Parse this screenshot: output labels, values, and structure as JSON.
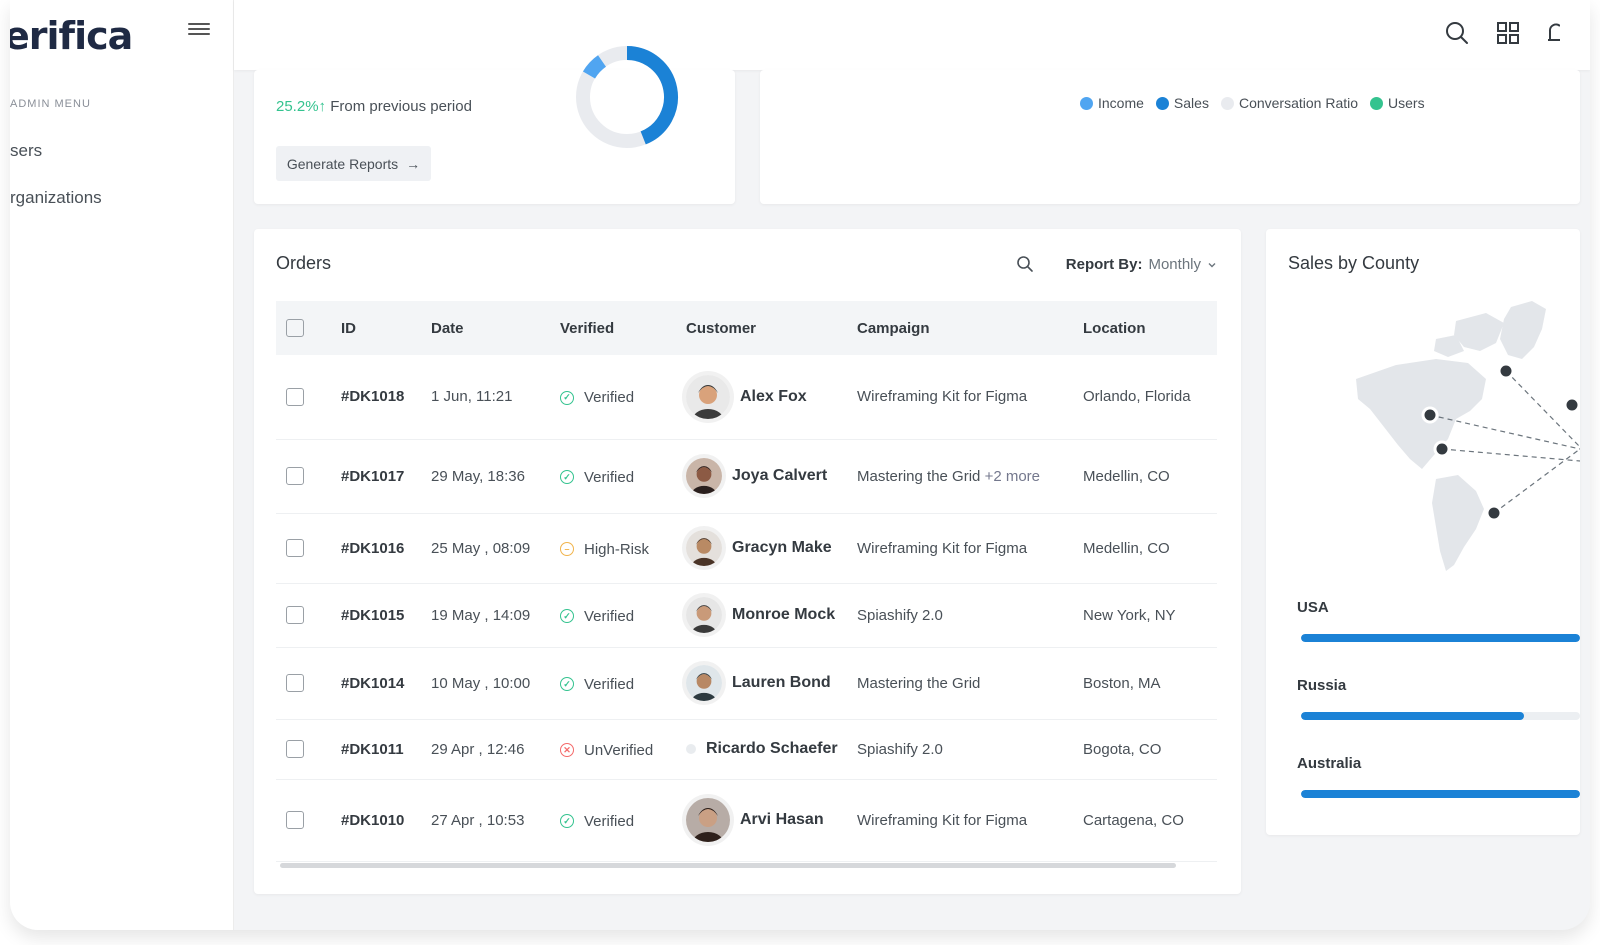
{
  "brand": {
    "logo": "erifica"
  },
  "sidebar": {
    "menu_title": "ADMIN MENU",
    "items": [
      {
        "label": "sers"
      },
      {
        "label": "rganizations"
      }
    ]
  },
  "summary": {
    "growth_pct": "25.2%",
    "growth_arrow": "↑",
    "growth_text": "From previous period",
    "generate_label": "Generate Reports",
    "generate_arrow": "→",
    "donut_fraction": 0.44
  },
  "legend": [
    {
      "label": "Income",
      "color": "#50a5f1"
    },
    {
      "label": "Sales",
      "color": "#1b82d6"
    },
    {
      "label": "Conversation Ratio",
      "color": "#e9ebef"
    },
    {
      "label": "Users",
      "color": "#34c38f"
    }
  ],
  "orders": {
    "title": "Orders",
    "report_label": "Report By:",
    "report_value": "Monthly",
    "columns": [
      "ID",
      "Date",
      "Verified",
      "Customer",
      "Campaign",
      "Location"
    ],
    "rows": [
      {
        "id": "#DK1018",
        "date": "1 Jun, 11:21",
        "status": "Verified",
        "status_type": "ok",
        "customer": "Alex Fox",
        "campaign": "Wireframing Kit for Figma",
        "more": "",
        "location": "Orlando, Florida"
      },
      {
        "id": "#DK1017",
        "date": "29 May, 18:36",
        "status": "Verified",
        "status_type": "ok",
        "customer": "Joya Calvert",
        "campaign": "Mastering the Grid",
        "more": "+2 more",
        "location": "Medellin, CO"
      },
      {
        "id": "#DK1016",
        "date": "25 May , 08:09",
        "status": "High-Risk",
        "status_type": "warn",
        "customer": "Gracyn Make",
        "campaign": "Wireframing Kit for Figma",
        "more": "",
        "location": "Medellin, CO"
      },
      {
        "id": "#DK1015",
        "date": "19 May , 14:09",
        "status": "Verified",
        "status_type": "ok",
        "customer": "Monroe Mock",
        "campaign": "Spiashify 2.0",
        "more": "",
        "location": "New York, NY"
      },
      {
        "id": "#DK1014",
        "date": "10 May , 10:00",
        "status": "Verified",
        "status_type": "ok",
        "customer": "Lauren Bond",
        "campaign": "Mastering the Grid",
        "more": "",
        "location": "Boston, MA"
      },
      {
        "id": "#DK1011",
        "date": "29 Apr , 12:46",
        "status": "UnVerified",
        "status_type": "bad",
        "customer": "Ricardo Schaefer",
        "campaign": "Spiashify 2.0",
        "more": "",
        "location": "Bogota, CO"
      },
      {
        "id": "#DK1010",
        "date": "27 Apr , 10:53",
        "status": "Verified",
        "status_type": "ok",
        "customer": "Arvi Hasan",
        "campaign": "Wireframing Kit for Figma",
        "more": "",
        "location": "Cartagena, CO"
      }
    ]
  },
  "county": {
    "title": "Sales by County",
    "countries": [
      {
        "name": "USA",
        "fraction": 1.0
      },
      {
        "name": "Russia",
        "fraction": 0.8
      },
      {
        "name": "Australia",
        "fraction": 1.0
      }
    ]
  },
  "colors": {
    "ok": "#34c38f",
    "warn": "#f1b44c",
    "bad": "#f46a6a"
  }
}
